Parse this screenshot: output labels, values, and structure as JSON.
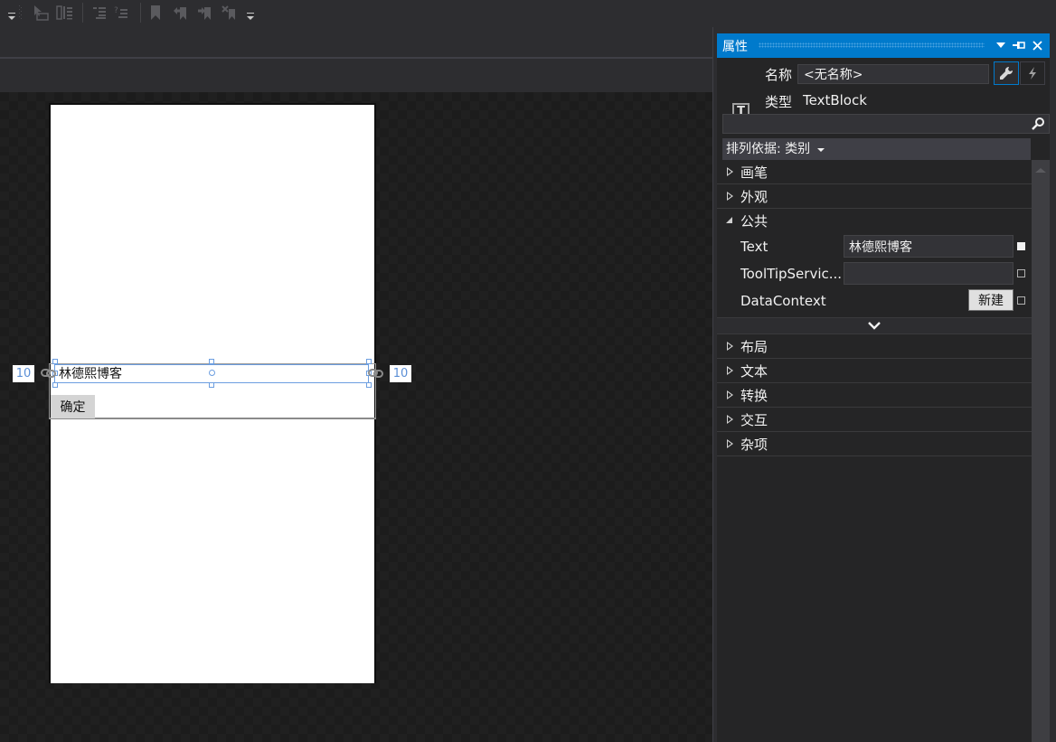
{
  "toolbar": {
    "buttons": [
      {
        "name": "select-tool-icon"
      },
      {
        "name": "align-panel-icon"
      },
      {
        "name": "indent-icon"
      },
      {
        "name": "comment-lines-icon"
      },
      {
        "name": "bookmark-icon"
      },
      {
        "name": "previous-bookmark-icon"
      },
      {
        "name": "next-bookmark-icon"
      },
      {
        "name": "clear-bookmarks-icon"
      }
    ]
  },
  "designer": {
    "textblock_text": "林德熙博客",
    "button_label": "确定",
    "left_margin": "10",
    "right_margin": "10"
  },
  "properties": {
    "title": "属性",
    "name_label": "名称",
    "name_value": "<无名称>",
    "type_label": "类型",
    "type_value": "TextBlock",
    "search_placeholder": "",
    "sort_label": "排列依据: 类别",
    "categories_before": [
      {
        "label": "画笔",
        "expanded": false
      },
      {
        "label": "外观",
        "expanded": false
      }
    ],
    "common": {
      "label": "公共",
      "expanded": true,
      "rows": [
        {
          "name": "Text",
          "value": "林德熙博客",
          "set": true
        },
        {
          "name": "ToolTipServic...",
          "value": "",
          "set": false
        },
        {
          "name": "DataContext",
          "button": "新建",
          "set": false
        }
      ]
    },
    "categories_after": [
      {
        "label": "布局",
        "expanded": false
      },
      {
        "label": "文本",
        "expanded": false
      },
      {
        "label": "转换",
        "expanded": false
      },
      {
        "label": "交互",
        "expanded": false
      },
      {
        "label": "杂项",
        "expanded": false
      }
    ]
  },
  "colors": {
    "accent": "#007acc",
    "selection": "#6c9ee0",
    "panel_bg": "#252526"
  }
}
